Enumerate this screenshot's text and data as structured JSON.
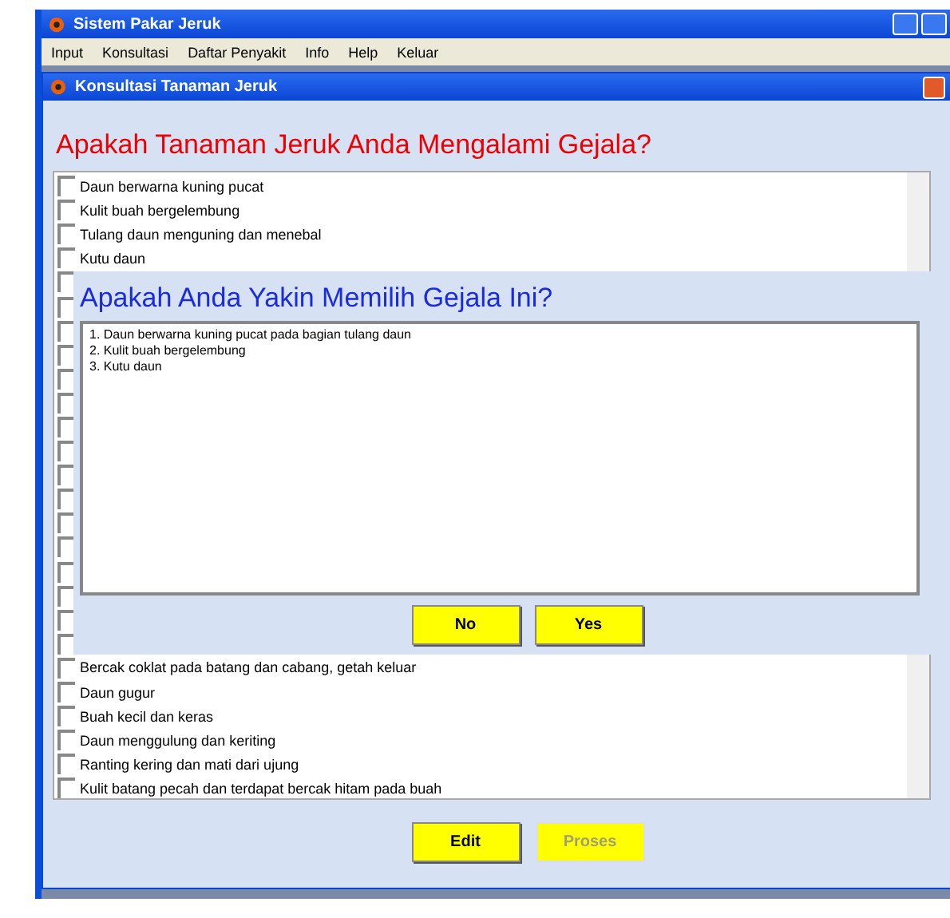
{
  "main_window": {
    "title": "Sistem Pakar Jeruk"
  },
  "menu": [
    "Input",
    "Konsultasi",
    "Daftar Penyakit",
    "Info",
    "Help",
    "Keluar"
  ],
  "dialog_window": {
    "title": "Konsultasi Tanaman Jeruk"
  },
  "question": "Apakah Tanaman Jeruk Anda Mengalami Gejala?",
  "symptoms": [
    {
      "label": "Daun berwarna kuning pucat",
      "checked": false
    },
    {
      "label": "Kulit buah bergelembung",
      "checked": false
    },
    {
      "label": "Tulang daun menguning dan menebal",
      "checked": false
    },
    {
      "label": "Kutu daun",
      "checked": false
    },
    {
      "checked": false
    },
    {
      "checked": false
    },
    {
      "checked": false
    },
    {
      "checked": false
    },
    {
      "checked": false
    },
    {
      "checked": false
    },
    {
      "checked": false
    },
    {
      "checked": false
    },
    {
      "checked": false
    },
    {
      "checked": false
    },
    {
      "checked": false
    },
    {
      "checked": false
    },
    {
      "checked": false
    },
    {
      "checked": false
    },
    {
      "checked": false
    },
    {
      "checked": false
    },
    {
      "label": "Bercak coklat pada batang dan cabang, getah keluar",
      "checked": false
    },
    {
      "label": "Daun gugur",
      "checked": false
    },
    {
      "label": "Buah kecil dan keras",
      "checked": false
    },
    {
      "label": "Daun menggulung dan keriting",
      "checked": false
    },
    {
      "label": "Ranting kering dan mati dari ujung",
      "checked": false
    },
    {
      "label": "Kulit batang pecah dan terdapat bercak hitam pada buah",
      "checked": false
    }
  ],
  "confirm": {
    "title": "Apakah Anda Yakin Memilih Gejala Ini?",
    "lines": [
      "1. Daun berwarna kuning pucat pada bagian tulang daun",
      "2. Kulit buah bergelembung",
      "3. Kutu daun"
    ],
    "buttons": [
      {
        "label": "No",
        "disabled": false
      },
      {
        "label": "Yes",
        "disabled": false
      }
    ]
  },
  "buttons": [
    {
      "label": "Edit",
      "disabled": false
    },
    {
      "label": "Proses",
      "disabled": true
    }
  ]
}
